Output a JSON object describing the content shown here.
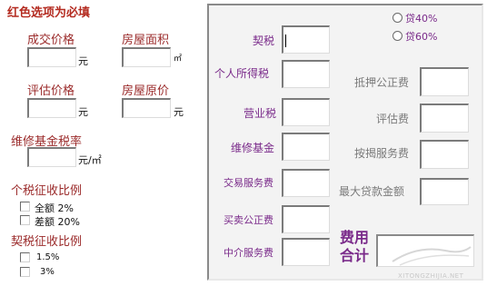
{
  "left": {
    "header": "红色选项为必填",
    "deal_price_label": "成交价格",
    "deal_price_unit": "元",
    "area_label": "房屋面积",
    "area_unit": "㎡",
    "appraisal_label": "评估价格",
    "appraisal_unit": "元",
    "original_price_label": "房屋原价",
    "original_price_unit": "元",
    "maint_rate_label": "维修基金税率",
    "maint_rate_unit": "元/㎡",
    "personal_tax_ratio_label": "个税征收比例",
    "full_amount_option": "全额  2%",
    "diff_amount_option": "差额 20%",
    "deed_tax_ratio_label": "契税征收比例",
    "deed_option_1": "1.5%",
    "deed_option_2": "3%"
  },
  "right": {
    "loan_40": "贷40%",
    "loan_60": "贷60%",
    "deed_tax_label": "契税",
    "personal_income_tax_label": "个人所得税",
    "business_tax_label": "营业税",
    "maint_fund_label": "维修基金",
    "transaction_fee_label": "交易服务费",
    "sale_notary_label": "买卖公正费",
    "agency_fee_label": "中介服务费",
    "mortgage_notary_label": "抵押公正费",
    "appraisal_fee_label": "评估费",
    "mortgage_service_label": "按揭服务费",
    "max_loan_label": "最大贷款金额",
    "total_fee_label": "费用合计"
  },
  "watermark": {
    "brand": "系统之家",
    "url": "XITONGZHIJIA.NET"
  }
}
